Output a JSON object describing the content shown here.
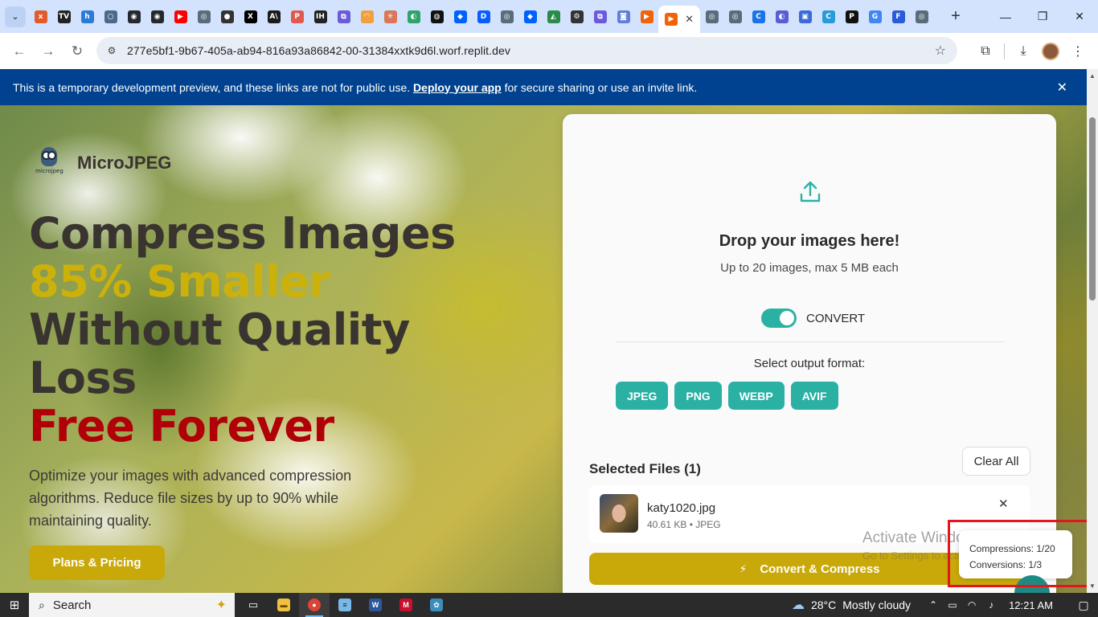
{
  "browser": {
    "tab_search_icon": "chevron-down-icon",
    "tabs": [
      {
        "name": "tab-1",
        "icon": "x",
        "color": "#e25b2c"
      },
      {
        "name": "tab-2",
        "icon": "TV",
        "color": "#222222"
      },
      {
        "name": "tab-3",
        "icon": "h",
        "color": "#2a7bd8"
      },
      {
        "name": "tab-4",
        "icon": "○",
        "color": "#4b6a8a"
      },
      {
        "name": "tab-5",
        "icon": "◉",
        "color": "#24292f"
      },
      {
        "name": "tab-6",
        "icon": "◉",
        "color": "#24292f"
      },
      {
        "name": "tab-7",
        "icon": "▶",
        "color": "#ff0000"
      },
      {
        "name": "tab-8",
        "icon": "◎",
        "color": "#5a6b7b"
      },
      {
        "name": "tab-9",
        "icon": "●",
        "color": "#333333"
      },
      {
        "name": "tab-10",
        "icon": "X",
        "color": "#000000"
      },
      {
        "name": "tab-11",
        "icon": "A\\",
        "color": "#1a1a1a"
      },
      {
        "name": "tab-12",
        "icon": "P",
        "color": "#e05a4f"
      },
      {
        "name": "tab-13",
        "icon": "IH",
        "color": "#222222"
      },
      {
        "name": "tab-14",
        "icon": "⧉",
        "color": "#6a5cd8"
      },
      {
        "name": "tab-15",
        "icon": "◠",
        "color": "#f2a03d"
      },
      {
        "name": "tab-16",
        "icon": "✳",
        "color": "#d97757"
      },
      {
        "name": "tab-17",
        "icon": "◐",
        "color": "#2ea36a"
      },
      {
        "name": "tab-18",
        "icon": "◍",
        "color": "#111111"
      },
      {
        "name": "tab-19",
        "icon": "◆",
        "color": "#0061fe"
      },
      {
        "name": "tab-20",
        "icon": "D",
        "color": "#0b5cff"
      },
      {
        "name": "tab-21",
        "icon": "◎",
        "color": "#5a6b7b"
      },
      {
        "name": "tab-22",
        "icon": "◆",
        "color": "#0061fe"
      },
      {
        "name": "tab-23",
        "icon": "◭",
        "color": "#2a8a4a"
      },
      {
        "name": "tab-24",
        "icon": "⚙",
        "color": "#333333"
      },
      {
        "name": "tab-25",
        "icon": "⧉",
        "color": "#6a5cd8"
      },
      {
        "name": "tab-26",
        "icon": "◙",
        "color": "#5f7fd8"
      },
      {
        "name": "tab-27",
        "icon": "▶",
        "color": "#f26207"
      }
    ],
    "active_tab": {
      "icon": "▶",
      "color": "#f26207",
      "close": "✕"
    },
    "tabs_after": [
      {
        "name": "tab-29",
        "icon": "◎",
        "color": "#5a6b7b"
      },
      {
        "name": "tab-30",
        "icon": "◎",
        "color": "#5a6b7b"
      },
      {
        "name": "tab-31",
        "icon": "C",
        "color": "#1a73e8"
      },
      {
        "name": "tab-32",
        "icon": "◐",
        "color": "#5b5bd6"
      },
      {
        "name": "tab-33",
        "icon": "▣",
        "color": "#3a6ad8"
      },
      {
        "name": "tab-34",
        "icon": "C",
        "color": "#2a9ad8"
      },
      {
        "name": "tab-35",
        "icon": "P",
        "color": "#111111"
      },
      {
        "name": "tab-36",
        "icon": "G",
        "color": "#4285f4"
      },
      {
        "name": "tab-37",
        "icon": "F",
        "color": "#2a5bd8"
      },
      {
        "name": "tab-38",
        "icon": "◎",
        "color": "#5a6b7b"
      }
    ],
    "new_tab_icon": "+",
    "window_controls": {
      "minimize": "—",
      "restore": "❐",
      "close": "✕"
    },
    "url": "277e5bf1-9b67-405a-ab94-816a93a86842-00-31384xxtk9d6l.worf.replit.dev"
  },
  "banner": {
    "text_before": "This is a temporary development preview, and these links are not for public use. ",
    "link": "Deploy your app",
    "text_after": " for secure sharing or use an invite link.",
    "close": "✕"
  },
  "hero": {
    "brand_name": "MicroJPEG",
    "logo_tag": "microjpeg",
    "headline": {
      "line1": "Compress Images",
      "line2": "85% Smaller",
      "line3": "Without Quality",
      "line4": "Loss",
      "line5": "Free Forever"
    },
    "subtext": "Optimize your images with advanced compression algorithms. Reduce file sizes by up to 90% while maintaining quality.",
    "plans_button": "Plans & Pricing"
  },
  "uploader": {
    "upload_icon": "upload-icon",
    "drop_title": "Drop your images here!",
    "drop_sub": "Up to 20 images, max 5 MB each",
    "convert_toggle_on": true,
    "convert_label": "CONVERT",
    "format_title": "Select output format:",
    "formats": [
      "JPEG",
      "PNG",
      "WEBP",
      "AVIF"
    ],
    "selected_title": "Selected Files (1)",
    "clear_all": "Clear All",
    "file": {
      "name": "katy1020.jpg",
      "meta": "40.61 KB • JPEG",
      "remove": "✕"
    },
    "convert_button": "Convert & Compress"
  },
  "watermark": {
    "title": "Activate Windows",
    "sub": "Go to Settings to activate Windows."
  },
  "usage": {
    "compressions": "Compressions: 1/20",
    "conversions": "Conversions: 1/3"
  },
  "taskbar": {
    "search": "Search",
    "weather_temp": "28°C",
    "weather_desc": "Mostly cloudy",
    "time": "12:21 AM"
  }
}
